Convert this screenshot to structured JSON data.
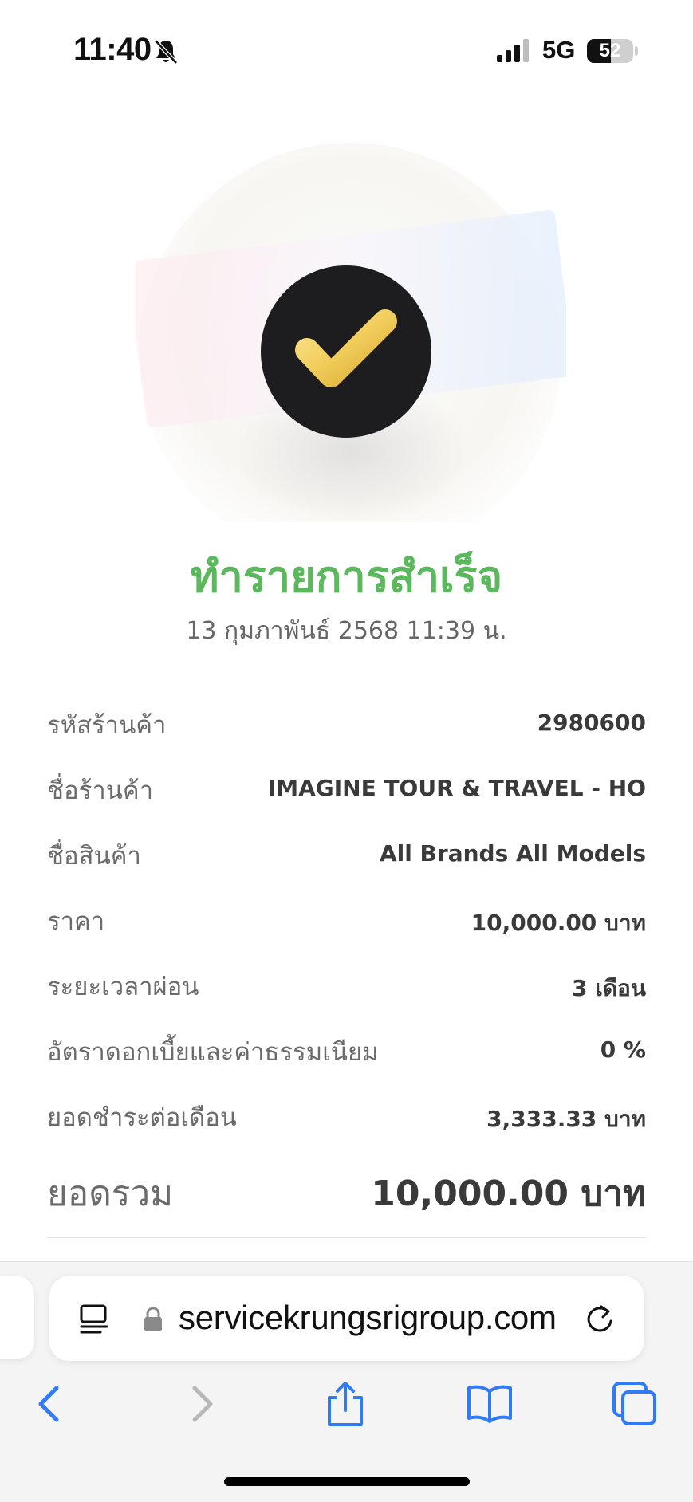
{
  "status_bar": {
    "time": "11:40",
    "network": "5G",
    "battery": "52",
    "battery_level": 0.52
  },
  "transaction": {
    "title": "ทำรายการสำเร็จ",
    "datetime": "13 กุมภาพันธ์ 2568 11:39 น.",
    "title_color": "#5cb85c"
  },
  "details": [
    {
      "label": "รหัสร้านค้า",
      "value": "2980600"
    },
    {
      "label": "ชื่อร้านค้า",
      "value": "IMAGINE TOUR & TRAVEL - HO"
    },
    {
      "label": "ชื่อสินค้า",
      "value": "All Brands All Models"
    },
    {
      "label": "ราคา",
      "value": "10,000.00 บาท"
    },
    {
      "label": "ระยะเวลาผ่อน",
      "value": "3 เดือน"
    },
    {
      "label": "อัตราดอกเบี้ยและค่าธรรมเนียม",
      "value": "0 %"
    },
    {
      "label": "ยอดชำระต่อเดือน",
      "value": "3,333.33 บาท"
    }
  ],
  "total": {
    "label": "ยอดรวม",
    "value": "10,000.00 บาท"
  },
  "browser": {
    "url": "servicekrungsrigroup.com",
    "accent_color": "#2f7bf5"
  },
  "icons": {
    "status": [
      "bell-slash-icon",
      "signal-icon",
      "battery-icon"
    ],
    "hero": "checkmark-icon",
    "address_bar": [
      "reader-icon",
      "lock-icon",
      "reload-icon"
    ],
    "nav": [
      "back-icon",
      "forward-icon",
      "share-icon",
      "bookmarks-icon",
      "tabs-icon"
    ]
  }
}
